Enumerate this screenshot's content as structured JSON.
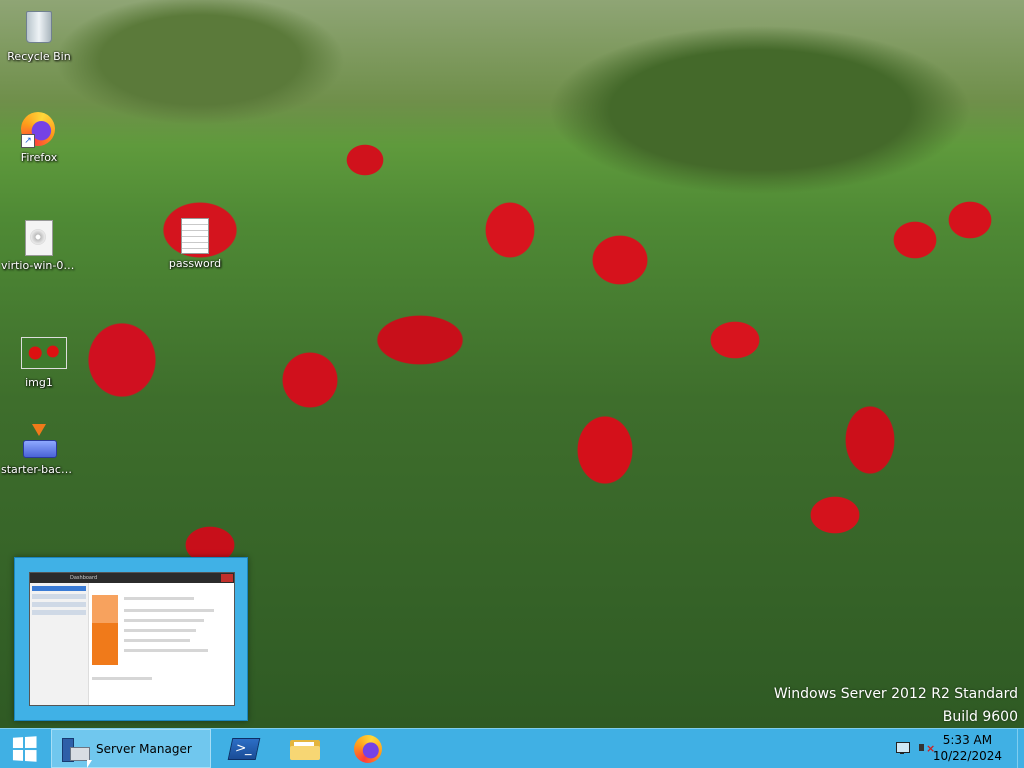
{
  "desktop": {
    "icons": [
      {
        "label": "Recycle Bin",
        "icon": "recycle-bin-icon"
      },
      {
        "label": "Firefox",
        "icon": "firefox-icon"
      },
      {
        "label": "virtio-win-0....",
        "icon": "disc-image-icon"
      },
      {
        "label": "password",
        "icon": "text-file-icon"
      },
      {
        "label": "img1",
        "icon": "image-file-icon"
      },
      {
        "label": "starter-back...",
        "icon": "installer-icon"
      }
    ],
    "watermark": {
      "edition": "Windows Server 2012 R2 Standard",
      "build": "Build 9600"
    }
  },
  "preview": {
    "window_title": "Dashboard",
    "description": "Server Manager window thumbnail"
  },
  "taskbar": {
    "buttons": [
      {
        "label": "",
        "icon": "windows-start-icon"
      },
      {
        "label": "Server Manager",
        "icon": "server-manager-icon",
        "active": true
      },
      {
        "label": "",
        "icon": "powershell-icon"
      },
      {
        "label": "",
        "icon": "file-explorer-icon"
      },
      {
        "label": "",
        "icon": "firefox-icon"
      }
    ],
    "tray": {
      "time": "5:33 AM",
      "date": "10/22/2024"
    }
  },
  "colors": {
    "taskbar": "#40b0e4",
    "taskbar_active": "#70c7ee"
  }
}
